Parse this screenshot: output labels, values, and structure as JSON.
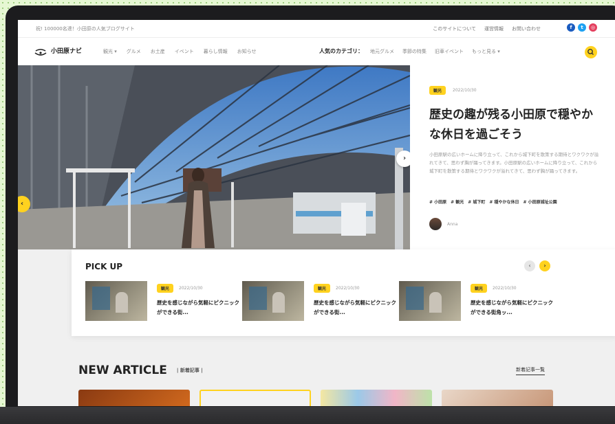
{
  "site": {
    "tagline": "祝! 100000名達！小田原の人気ブログサイト",
    "logo_text": "小田原ナビ",
    "top_links": [
      "このサイトについて",
      "運営情報",
      "お問い合わせ"
    ],
    "sns_icons": [
      {
        "name": "facebook-icon",
        "glyph": "f",
        "color": "#1a5bbf"
      },
      {
        "name": "twitter-icon",
        "glyph": "t",
        "color": "#1da1f2"
      },
      {
        "name": "instagram-icon",
        "glyph": "◎",
        "color": "#e4405f"
      }
    ]
  },
  "nav": {
    "menu": [
      "観光 ▾",
      "グルメ",
      "お土産",
      "イベント",
      "暮らし情報",
      "お知らせ"
    ],
    "categories_label": "人気のカテゴリ：",
    "categories": [
      "地元グルメ",
      "季節の特集",
      "旧車イベント",
      "もっと見る ▾"
    ],
    "search_icon": "search-icon"
  },
  "hero": {
    "badge": "観光",
    "date": "2022/10/30",
    "title": "歴史の趣が残る小田原で穏やかな休日を過ごそう",
    "description": "小田原駅の広いホームに降り立って、これから城下町を散策する期待とワクワクが溢れてきて、思わず胸が踊ってきます。小田原駅の広いホームに降り立って、これから城下町を散策する期待とワクワクが溢れてきて、思わず胸が踊ってきます。",
    "tags": [
      "# 小田原",
      "# 観光",
      "# 城下町",
      "# 穏やかな休日",
      "# 小田原城址公園"
    ],
    "author": "Anna",
    "prev_arrow": "‹",
    "next_arrow": "›"
  },
  "pickup": {
    "title": "PICK UP",
    "prev": "‹",
    "next": "›",
    "items": [
      {
        "badge": "観光",
        "date": "2022/10/30",
        "title": "歴史を感じながら気軽にピクニックができる街..."
      },
      {
        "badge": "観光",
        "date": "2022/10/30",
        "title": "歴史を感じながら気軽にピクニックができる街..."
      },
      {
        "badge": "観光",
        "date": "2022/10/30",
        "title": "歴史を感じながら気軽にピクニックができる街角ッ..."
      }
    ]
  },
  "new_article": {
    "title": "NEW ARTICLE",
    "subtitle": "|  新着記事  |",
    "view_all": "新着記事一覧"
  },
  "colors": {
    "accent": "#ffd21f",
    "text": "#222222",
    "muted": "#999999"
  }
}
